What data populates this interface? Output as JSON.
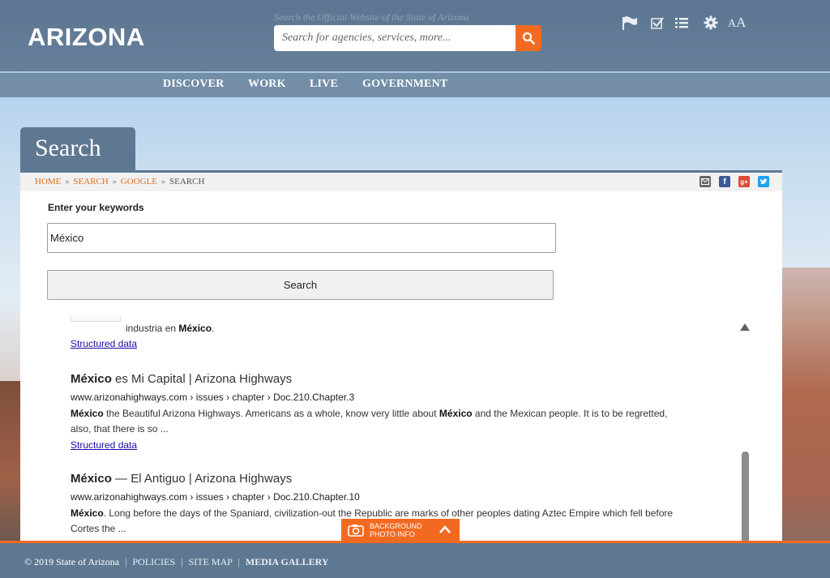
{
  "header": {
    "logo": "ARIZONA",
    "search_hint": "Search the Official Website of the State of Arizona",
    "search_placeholder": "Search for agencies, services, more...",
    "tools": [
      "flag-icon",
      "checkbox-icon",
      "list-icon",
      "gear-icon"
    ],
    "font_size_small": "A",
    "font_size_large": "A"
  },
  "nav": [
    "DISCOVER",
    "WORK",
    "LIVE",
    "GOVERNMENT"
  ],
  "page": {
    "title": "Search",
    "breadcrumbs": [
      "HOME",
      "SEARCH",
      "GOOGLE",
      "SEARCH"
    ],
    "breadcrumb_sep": "»",
    "share": [
      {
        "icon": "email-icon",
        "color": "#666666"
      },
      {
        "icon": "facebook-icon",
        "color": "#3b5998",
        "glyph": "f"
      },
      {
        "icon": "google-plus-icon",
        "color": "#dd4b39",
        "glyph": "g+"
      },
      {
        "icon": "twitter-icon",
        "color": "#1da1f2"
      }
    ]
  },
  "form": {
    "keywords_label": "Enter your keywords",
    "keywords_value": "México",
    "search_button": "Search"
  },
  "results": {
    "partial_snippet": {
      "before": "industria en ",
      "bold": "México",
      "after": "."
    },
    "partial_structured_data": "Structured data",
    "items": [
      {
        "title_bold": "México",
        "title_rest": " es Mi Capital | Arizona Highways",
        "url": "www.arizonahighways.com › issues › chapter › Doc.210.Chapter.3",
        "snippet_line1_bold": "México",
        "snippet_line1_mid": " the Beautiful Arizona Highways. Americans as a whole, know very little about ",
        "snippet_line1_bold2": "México",
        "snippet_line1_after": " and the Mexican people. It is to be regretted,",
        "snippet_line2": "also, that there is so ...",
        "structured_data": "Structured data"
      },
      {
        "title_bold": "México",
        "title_rest": " — El Antiguo | Arizona Highways",
        "url": "www.arizonahighways.com › issues › chapter › Doc.210.Chapter.10",
        "snippet_line1_bold": "México",
        "snippet_line1_after": ". Long before the days of the Spaniard, civilization-out the Republic are marks of other peoples dating Aztec Empire which fell before",
        "snippet_line2": "Cortes the ..."
      }
    ]
  },
  "photo_info": {
    "line1": "BACKGROUND",
    "line2": "PHOTO INFO"
  },
  "footer": {
    "copyright": "© 2019 State of Arizona",
    "policies": "POLICIES",
    "site_map": "SITE MAP",
    "media_gallery": "MEDIA GALLERY",
    "sep": "|"
  },
  "colors": {
    "accent": "#f26a21",
    "header_blue": "#5e7892",
    "link_blue": "#1a0dab"
  }
}
